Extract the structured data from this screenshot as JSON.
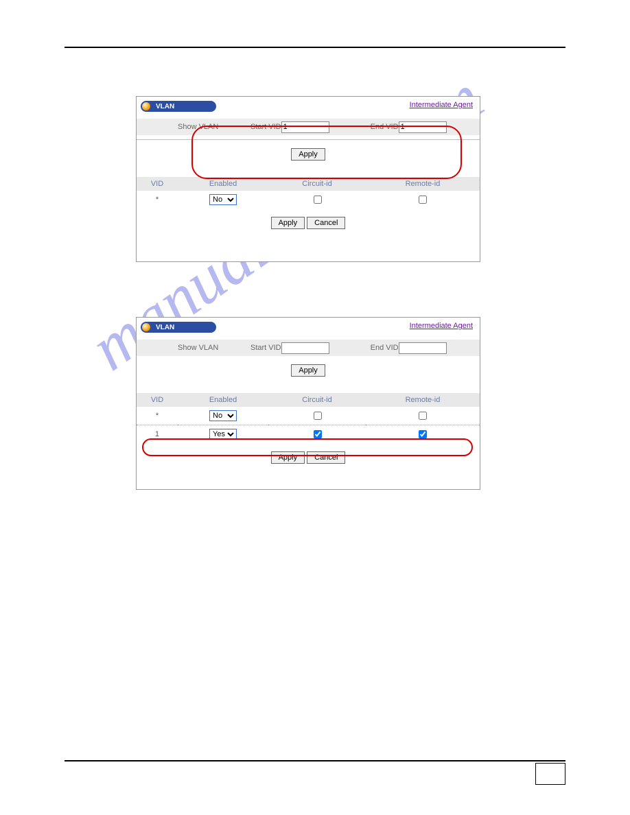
{
  "watermark": "manualshive.com",
  "panels": {
    "tab_label": "VLAN",
    "ia_link": "Intermediate Agent",
    "filter": {
      "show_label": "Show VLAN",
      "start_label": "Start VID",
      "end_label": "End VID",
      "apply_label": "Apply"
    },
    "table": {
      "headers": {
        "vid": "VID",
        "enabled": "Enabled",
        "circuit": "Circuit-id",
        "remote": "Remote-id"
      }
    },
    "actions": {
      "apply": "Apply",
      "cancel": "Cancel"
    },
    "select_options": {
      "no": "No",
      "yes": "Yes"
    }
  },
  "panel1": {
    "start_vid": "1",
    "end_vid": "1",
    "rows": [
      {
        "vid": "*",
        "enabled": "No",
        "circuit": false,
        "remote": false
      }
    ]
  },
  "panel2": {
    "start_vid": "",
    "end_vid": "",
    "rows": [
      {
        "vid": "*",
        "enabled": "No",
        "circuit": false,
        "remote": false
      },
      {
        "vid": "1",
        "enabled": "Yes",
        "circuit": true,
        "remote": true
      }
    ]
  }
}
